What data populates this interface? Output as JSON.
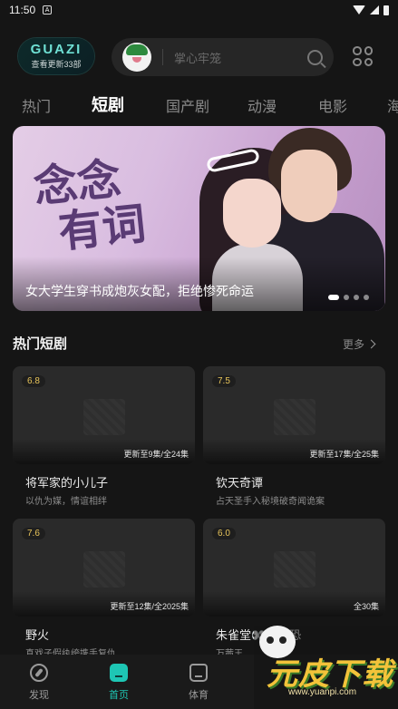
{
  "status_bar": {
    "time": "11:50",
    "notification_badge": "A"
  },
  "header": {
    "logo_brand": "GUAZI",
    "logo_sub": "查看更新33部",
    "search_placeholder": "掌心牢笼"
  },
  "tabs": [
    "热门",
    "短剧",
    "国产剧",
    "动漫",
    "电影",
    "海"
  ],
  "active_tab": "短剧",
  "banner": {
    "title_line1": "念念",
    "title_line2": "有词",
    "caption": "女大学生穿书成炮灰女配，拒绝惨死命运",
    "dots": 4,
    "active_dot": 0
  },
  "section": {
    "title": "热门短剧",
    "more": "更多"
  },
  "cards": [
    {
      "score": "6.8",
      "episodes": "更新至9集/全24集",
      "name": "将军家的小儿子",
      "desc": "以仇为媒，情谊相绊"
    },
    {
      "score": "7.5",
      "episodes": "更新至17集/全25集",
      "name": "钦天奇谭",
      "desc": "占天圣手入秘境破奇闻诡案"
    },
    {
      "score": "7.6",
      "episodes": "更新至12集/全2025集",
      "name": "野火",
      "desc": "真戏子假纨绔携手复仇"
    },
    {
      "score": "6.0",
      "episodes": "全30集",
      "name": "朱雀堂👀中式恐",
      "desc": "万茜王..."
    }
  ],
  "bottom_nav": [
    {
      "label": "发现",
      "icon": "compass-icon"
    },
    {
      "label": "首页",
      "icon": "home-icon",
      "active": true
    },
    {
      "label": "体育",
      "icon": "tv-icon"
    }
  ],
  "watermark": {
    "text": "元皮下载",
    "url": "www.yuanpi.com"
  },
  "colors": {
    "accent": "#1ec6b4",
    "score": "#e8c45a",
    "background": "#151515"
  }
}
